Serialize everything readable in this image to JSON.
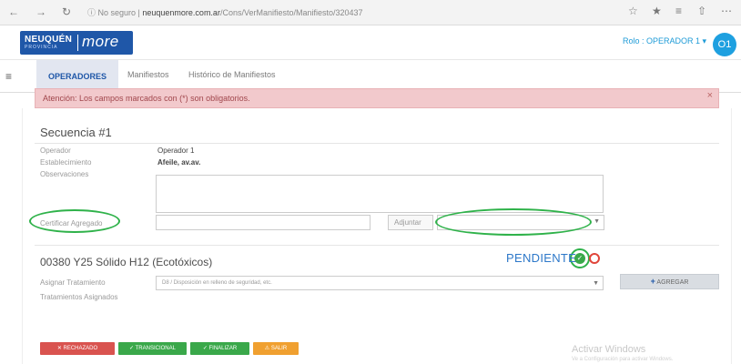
{
  "browser": {
    "back_icon": "arrow-left-icon",
    "forward_icon": "arrow-right-icon",
    "refresh_icon": "refresh-icon",
    "security_label": "No seguro",
    "url_host": "neuquenmore.com.ar",
    "url_path": "/Cons/VerManifiesto/Manifiesto/320437"
  },
  "app": {
    "logo_line1": "NEUQUÉN",
    "logo_line2": "PROVINCIA",
    "logo_word": "more",
    "user_menu": "Rolo : OPERADOR 1 ▾",
    "avatar_initials": "O1",
    "brand_color": "#1f57a8",
    "accent_color": "#1ea0e0"
  },
  "tabs": {
    "items": [
      {
        "label": "OPERADORES"
      },
      {
        "label": "Manifiestos"
      },
      {
        "label": "Histórico de Manifiestos"
      }
    ]
  },
  "alert": {
    "text": "Atención: Los campos marcados con (*) son obligatorios.",
    "close": "×"
  },
  "sequence": {
    "title": "Secuencia #1",
    "operator_label": "Operador",
    "operator_value": "Operador 1",
    "establishment_label": "Establecimiento",
    "establishment_value": "Afeile, av.av.",
    "observations_label": "Observaciones",
    "certificate_label": "Certificar Agregado",
    "attach_label": "Adjuntar"
  },
  "item": {
    "title": "00380 Y25 Sólido H12 (Ecotóxicos)",
    "status": "PENDIENTE",
    "status_color": "#2d78c9",
    "treatment_label": "Asignar Tratamiento",
    "treatment_value": "D8 / Disposición en relleno de seguridad, etc.",
    "assigned_label": "Tratamientos Asignados",
    "add_label": "AGREGAR"
  },
  "actions": [
    {
      "label": "✕ RECHAZADO",
      "color": "#d9534f"
    },
    {
      "label": "✓ TRANSICIONAL",
      "color": "#3aa84a"
    },
    {
      "label": "✓ FINALIZAR",
      "color": "#3aa84a"
    },
    {
      "label": "⚠ SALIR",
      "color": "#f0a030"
    }
  ],
  "windows_watermark": {
    "line1": "Activar Windows",
    "line2": "Ve a Configuración para activar Windows."
  }
}
